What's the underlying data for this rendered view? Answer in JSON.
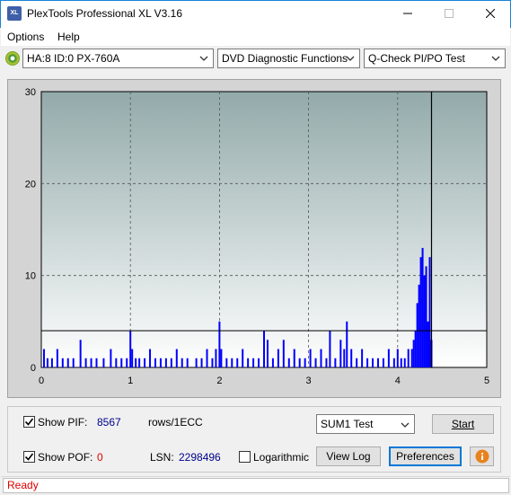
{
  "window": {
    "title": "PlexTools Professional XL V3.16",
    "icon_text": "XL"
  },
  "menu": [
    "Options",
    "Help"
  ],
  "toolbar": {
    "drive": "HA:8 ID:0  PX-760A",
    "function": "DVD Diagnostic Functions",
    "test": "Q-Check PI/PO Test"
  },
  "chart_data": {
    "type": "bar",
    "xlim": [
      0,
      5
    ],
    "ylim": [
      0,
      30
    ],
    "x_ticks": [
      "0",
      "1",
      "2",
      "3",
      "4",
      "5"
    ],
    "y_ticks": [
      "0",
      "10",
      "20",
      "30"
    ],
    "threshold": 4,
    "position_marker": 4.38,
    "grid": true,
    "series": [
      {
        "color": "#0000ff",
        "x": [
          0.03,
          0.07,
          0.12,
          0.18,
          0.24,
          0.3,
          0.36,
          0.44,
          0.5,
          0.56,
          0.62,
          0.7,
          0.78,
          0.84,
          0.9,
          0.96,
          1.0,
          1.02,
          1.06,
          1.1,
          1.16,
          1.22,
          1.28,
          1.34,
          1.4,
          1.46,
          1.52,
          1.58,
          1.64,
          1.74,
          1.8,
          1.86,
          1.92,
          1.96,
          2.0,
          2.02,
          2.08,
          2.14,
          2.2,
          2.26,
          2.32,
          2.38,
          2.44,
          2.5,
          2.54,
          2.6,
          2.66,
          2.72,
          2.78,
          2.84,
          2.9,
          2.96,
          3.02,
          3.08,
          3.14,
          3.2,
          3.24,
          3.3,
          3.36,
          3.4,
          3.43,
          3.48,
          3.54,
          3.6,
          3.66,
          3.72,
          3.78,
          3.84,
          3.9,
          3.96,
          4.0,
          4.04,
          4.08,
          4.12,
          4.16,
          4.18,
          4.2,
          4.22,
          4.24,
          4.26,
          4.28,
          4.3,
          4.32,
          4.34,
          4.36,
          4.38
        ],
        "y": [
          2,
          1,
          1,
          2,
          1,
          1,
          1,
          3,
          1,
          1,
          1,
          1,
          2,
          1,
          1,
          1,
          4,
          2,
          1,
          1,
          1,
          2,
          1,
          1,
          1,
          1,
          2,
          1,
          1,
          1,
          1,
          2,
          1,
          2,
          5,
          2,
          1,
          1,
          1,
          2,
          1,
          1,
          1,
          4,
          3,
          1,
          2,
          3,
          1,
          2,
          1,
          1,
          2,
          1,
          2,
          1,
          4,
          1,
          3,
          2,
          5,
          2,
          1,
          2,
          1,
          1,
          1,
          1,
          2,
          1,
          2,
          1,
          1,
          2,
          2,
          3,
          4,
          7,
          9,
          12,
          13,
          10,
          11,
          5,
          12,
          3
        ]
      }
    ]
  },
  "controls": {
    "show_pif_label": "Show PIF:",
    "pif_value": "8567",
    "pif_unit": "rows/1ECC",
    "show_pof_label": "Show POF:",
    "pof_value": "0",
    "lsn_label": "LSN:",
    "lsn_value": "2298496",
    "logarithmic_label": "Logarithmic",
    "sum_select": "SUM1 Test",
    "start": "Start",
    "view_log": "View Log",
    "preferences": "Preferences"
  },
  "status": "Ready"
}
